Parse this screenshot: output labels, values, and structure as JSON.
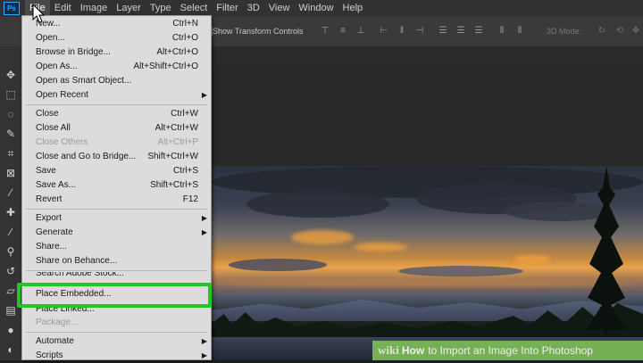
{
  "menubar": {
    "logo": "Ps",
    "items": [
      "File",
      "Edit",
      "Image",
      "Layer",
      "Type",
      "Select",
      "Filter",
      "3D",
      "View",
      "Window",
      "Help"
    ],
    "active_index": 0
  },
  "options_bar": {
    "show_transform_label": "Show Transform Controls",
    "mode_label": "3D Mode:"
  },
  "file_menu": {
    "items": [
      {
        "label": "New...",
        "shortcut": "Ctrl+N"
      },
      {
        "label": "Open...",
        "shortcut": "Ctrl+O"
      },
      {
        "label": "Browse in Bridge...",
        "shortcut": "Alt+Ctrl+O"
      },
      {
        "label": "Open As...",
        "shortcut": "Alt+Shift+Ctrl+O"
      },
      {
        "label": "Open as Smart Object...",
        "shortcut": ""
      },
      {
        "label": "Open Recent",
        "shortcut": "",
        "submenu": true
      },
      {
        "label": "Close",
        "shortcut": "Ctrl+W"
      },
      {
        "label": "Close All",
        "shortcut": "Alt+Ctrl+W"
      },
      {
        "label": "Close Others",
        "shortcut": "Alt+Ctrl+P",
        "disabled": true
      },
      {
        "label": "Close and Go to Bridge...",
        "shortcut": "Shift+Ctrl+W"
      },
      {
        "label": "Save",
        "shortcut": "Ctrl+S"
      },
      {
        "label": "Save As...",
        "shortcut": "Shift+Ctrl+S"
      },
      {
        "label": "Revert",
        "shortcut": "F12"
      },
      {
        "label": "Export",
        "shortcut": "",
        "submenu": true
      },
      {
        "label": "Generate",
        "shortcut": "",
        "submenu": true
      },
      {
        "label": "Share...",
        "shortcut": ""
      },
      {
        "label": "Share on Behance...",
        "shortcut": ""
      },
      {
        "label": "Search Adobe Stock...",
        "shortcut": ""
      },
      {
        "label": "Place Embedded...",
        "shortcut": ""
      },
      {
        "label": "Place Linked...",
        "shortcut": ""
      },
      {
        "label": "Package...",
        "shortcut": "",
        "disabled": true
      },
      {
        "label": "Automate",
        "shortcut": "",
        "submenu": true
      },
      {
        "label": "Scripts",
        "shortcut": "",
        "submenu": true
      }
    ],
    "highlighted": "Place Embedded..."
  },
  "watermark": {
    "brand": "wiki",
    "how": "How",
    "title": "to Import an Image Into Photoshop"
  },
  "colors": {
    "highlight_border": "#22c722",
    "menu_bg": "#dcdcdc",
    "app_bg": "#1e1e1e",
    "watermark_bg": "#7dbb57"
  }
}
